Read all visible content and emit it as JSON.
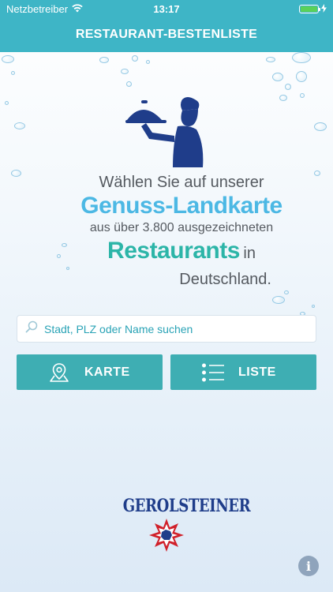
{
  "status_bar": {
    "carrier": "Netzbetreiber",
    "time": "13:17",
    "battery_level": 1.0
  },
  "nav": {
    "title": "RESTAURANT-BESTENLISTE"
  },
  "intro": {
    "line1": "Wählen Sie auf unserer",
    "line2": "Genuss-Landkarte",
    "line3": "aus über 3.800 ausgezeichneten",
    "line4_big": "Restaurants",
    "line4_small": "in",
    "line5": "Deutschland."
  },
  "search": {
    "placeholder": "Stadt, PLZ oder Name suchen",
    "value": ""
  },
  "buttons": {
    "karte": {
      "label": "KARTE",
      "icon": "map-pin-icon"
    },
    "liste": {
      "label": "LISTE",
      "icon": "list-icon"
    }
  },
  "logo": {
    "text": "GEROLSTEINER"
  },
  "colors": {
    "accent": "#3eb5c6",
    "button": "#3eaeb3",
    "highlight_blue": "#4cb8e4",
    "highlight_teal": "#2cb5a8",
    "logo_blue": "#1f3d8a",
    "logo_red": "#d0202a"
  }
}
